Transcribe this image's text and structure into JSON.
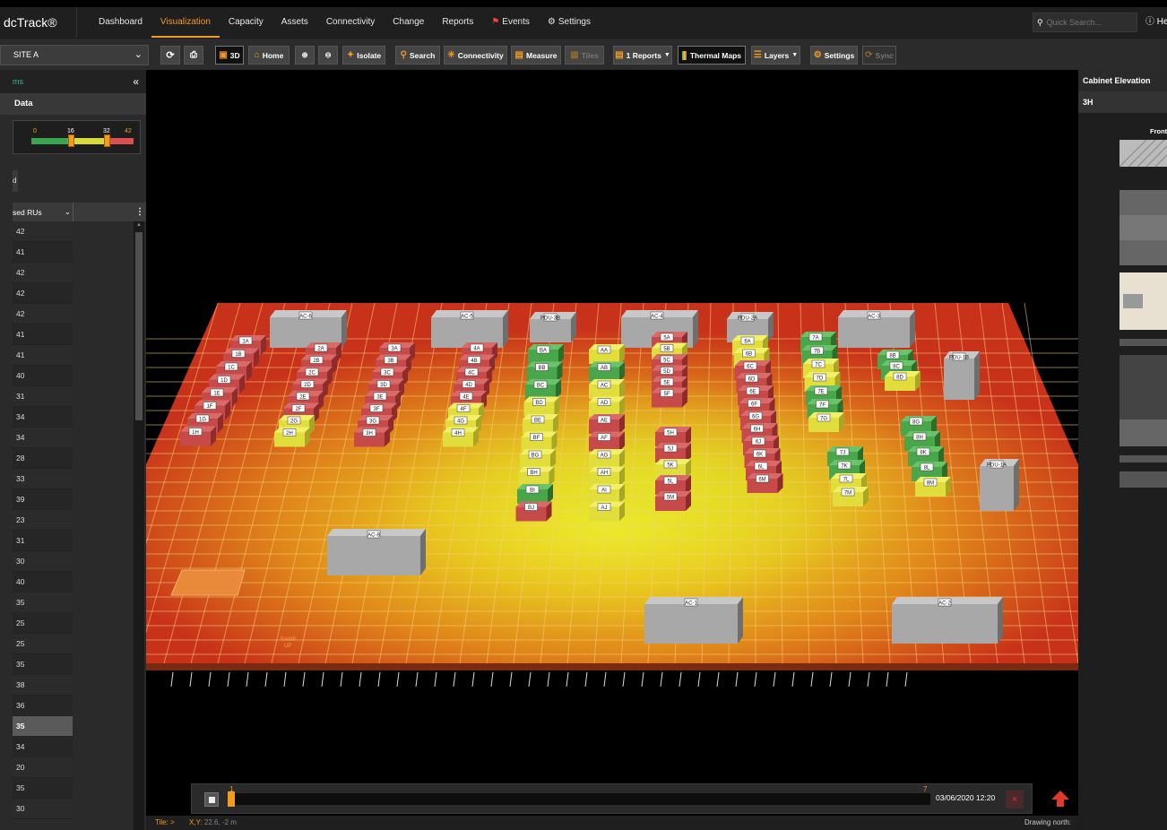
{
  "brand": "dcTrack®",
  "nav": {
    "dashboard": "Dashboard",
    "visualization": "Visualization",
    "capacity": "Capacity",
    "assets": "Assets",
    "connectivity": "Connectivity",
    "change": "Change",
    "reports": "Reports",
    "events": "Events",
    "settings": "Settings"
  },
  "quick_search_placeholder": "Quick Search...",
  "help": "He",
  "toolbar": {
    "site": "SITE A",
    "btn_3d": "3D",
    "home": "Home",
    "isolate": "Isolate",
    "search": "Search",
    "connectivity": "Connectivity",
    "measure": "Measure",
    "tiles": "Tiles",
    "reports": "1 Reports",
    "thermal": "Thermal Maps",
    "layers": "Layers",
    "settings": "Settings",
    "sync": "Sync"
  },
  "left_panel": {
    "title": "ms",
    "subtitle": "Data",
    "legend": [
      "0",
      "16",
      "32",
      "42"
    ],
    "mini": "d",
    "column_header": "sed RUs",
    "rows": [
      "42",
      "41",
      "42",
      "42",
      "42",
      "41",
      "41",
      "40",
      "31",
      "34",
      "34",
      "28",
      "33",
      "39",
      "23",
      "31",
      "30",
      "40",
      "35",
      "25",
      "25",
      "35",
      "38",
      "36",
      "35",
      "34",
      "20",
      "35",
      "30"
    ],
    "selected_row": 24
  },
  "scene": {
    "ac_units": [
      "AC-6",
      "AC-5",
      "AC-4",
      "AC-3",
      "AC-8",
      "AC-1",
      "AC-2"
    ],
    "pdu_units": [
      "PDU-3B",
      "PDU-2A",
      "PDU-1B",
      "PDU-1A"
    ],
    "ramp": [
      "RAMP",
      "UP"
    ],
    "rows": {
      "r1": [
        "1A",
        "1B",
        "1C",
        "1D",
        "1E",
        "1F",
        "1G",
        "1H"
      ],
      "r2": [
        "2A",
        "2B",
        "2C",
        "2D",
        "2E",
        "2F",
        "2G",
        "2H"
      ],
      "r3": [
        "3A",
        "3B",
        "3C",
        "3D",
        "3E",
        "3F",
        "3G",
        "3H"
      ],
      "r4": [
        "4A",
        "4B",
        "4C",
        "4D",
        "4E",
        "4F",
        "4G",
        "4H"
      ],
      "rB": [
        "BA",
        "BB",
        "BC",
        "BD",
        "BE",
        "BF",
        "BG",
        "BH",
        "BI",
        "BJ"
      ],
      "rA": [
        "AA",
        "AB",
        "AC",
        "AD",
        "AE",
        "AF",
        "AG",
        "AH",
        "AI",
        "AJ"
      ],
      "r5a": [
        "5A",
        "5B",
        "5C",
        "5D",
        "5E",
        "5F"
      ],
      "r5b": [
        "5H",
        "5J",
        "5K",
        "5L",
        "5M"
      ],
      "r6": [
        "6A",
        "6B",
        "6C",
        "6D",
        "6E",
        "6F",
        "6G",
        "6H",
        "6J",
        "6K",
        "6L",
        "6M"
      ],
      "r7a": [
        "7A",
        "7B",
        "7C",
        "7D",
        "7E",
        "7F",
        "7G"
      ],
      "r7b": [
        "7J",
        "7K",
        "7L",
        "7M"
      ],
      "r8a": [
        "8B",
        "8C",
        "8D"
      ],
      "r8b": [
        "8G",
        "8H",
        "8K",
        "8L",
        "8M"
      ]
    }
  },
  "timeline": {
    "start": "1",
    "end": "7",
    "datetime": "03/06/2020 12:20",
    "close": "×"
  },
  "status": {
    "tile_label": "Tile: >",
    "xy_label": "X,Y:",
    "xy_value": "22.6, -2 m",
    "north": "Drawing north:"
  },
  "right_panel": {
    "title": "Cabinet Elevation",
    "cabinet": "3H",
    "front": "Front"
  }
}
